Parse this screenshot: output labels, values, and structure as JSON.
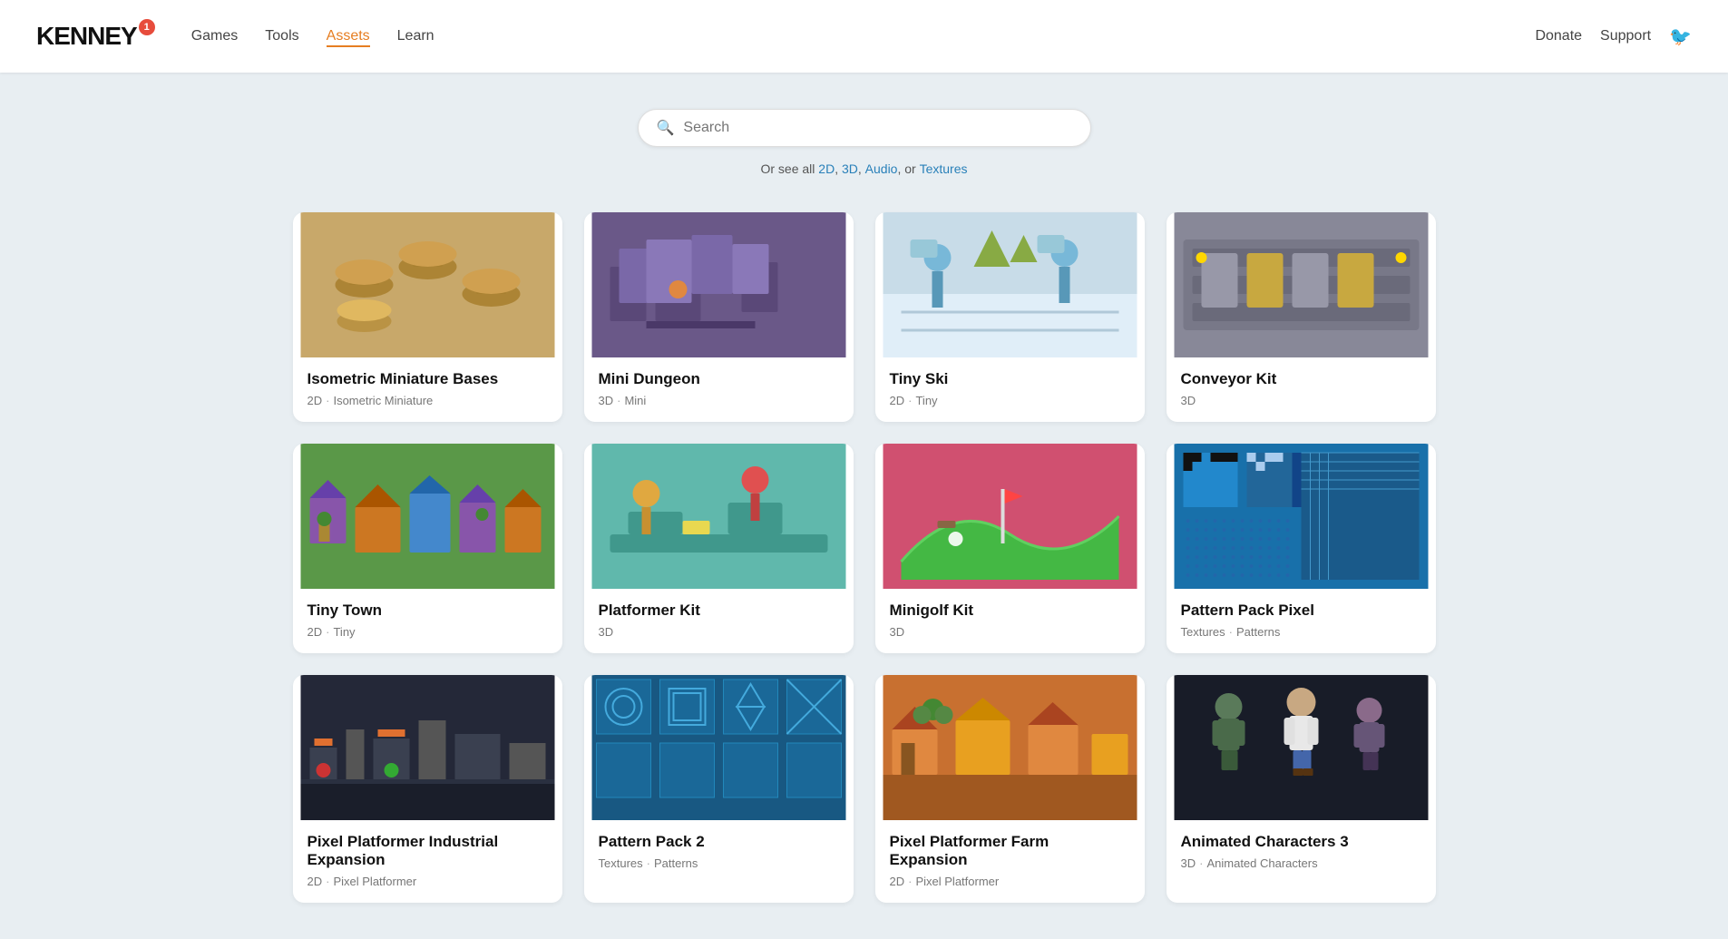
{
  "nav": {
    "logo": "KENNEY",
    "badge": "1",
    "links": [
      {
        "label": "Games",
        "href": "#",
        "active": false
      },
      {
        "label": "Tools",
        "href": "#",
        "active": false
      },
      {
        "label": "Assets",
        "href": "#",
        "active": true
      },
      {
        "label": "Learn",
        "href": "#",
        "active": false
      }
    ],
    "right_links": [
      {
        "label": "Donate",
        "href": "#"
      },
      {
        "label": "Support",
        "href": "#"
      }
    ]
  },
  "search": {
    "placeholder": "Search",
    "filter_text": "Or see all",
    "filter_links": [
      "2D",
      "3D",
      "Audio",
      "Textures"
    ]
  },
  "assets": [
    {
      "id": "isometric-miniature-bases",
      "title": "Isometric Miniature Bases",
      "tags": [
        "2D",
        "Isometric Miniature"
      ],
      "bg": "tan",
      "color1": "#c4a96e",
      "color2": "#d4b97e"
    },
    {
      "id": "mini-dungeon",
      "title": "Mini Dungeon",
      "tags": [
        "3D",
        "Mini"
      ],
      "bg": "purple",
      "color1": "#7c6fa0",
      "color2": "#9080b0"
    },
    {
      "id": "tiny-ski",
      "title": "Tiny Ski",
      "tags": [
        "2D",
        "Tiny"
      ],
      "bg": "lightblue",
      "color1": "#b8d8e8",
      "color2": "#d0eaf4"
    },
    {
      "id": "conveyor-kit",
      "title": "Conveyor Kit",
      "tags": [
        "3D"
      ],
      "bg": "gray",
      "color1": "#8a8a9a",
      "color2": "#9a9aaa"
    },
    {
      "id": "tiny-town",
      "title": "Tiny Town",
      "tags": [
        "2D",
        "Tiny"
      ],
      "bg": "green",
      "color1": "#5c9e4a",
      "color2": "#6cae5a"
    },
    {
      "id": "platformer-kit",
      "title": "Platformer Kit",
      "tags": [
        "3D"
      ],
      "bg": "teal",
      "color1": "#6ec4b8",
      "color2": "#8ed4c8"
    },
    {
      "id": "minigolf-kit",
      "title": "Minigolf Kit",
      "tags": [
        "3D"
      ],
      "bg": "pink",
      "color1": "#e86688",
      "color2": "#f87898"
    },
    {
      "id": "pattern-pack-pixel",
      "title": "Pattern Pack Pixel",
      "tags": [
        "Textures",
        "Patterns"
      ],
      "bg": "blue",
      "color1": "#1a7fbf",
      "color2": "#2a8fcf"
    },
    {
      "id": "pixel-platformer-industrial",
      "title": "Pixel Platformer Industrial Expansion",
      "tags": [
        "2D",
        "Pixel Platformer"
      ],
      "bg": "darkbg",
      "color1": "#2a3040",
      "color2": "#3a4050"
    },
    {
      "id": "pattern-pack-2",
      "title": "Pattern Pack 2",
      "tags": [
        "Textures",
        "Patterns"
      ],
      "bg": "bluegrid",
      "color1": "#1a6090",
      "color2": "#2a70a0"
    },
    {
      "id": "pixel-platformer-farm",
      "title": "Pixel Platformer Farm Expansion",
      "tags": [
        "2D",
        "Pixel Platformer"
      ],
      "bg": "orange",
      "color1": "#d4803a",
      "color2": "#e4904a"
    },
    {
      "id": "animated-characters-3",
      "title": "Animated Characters 3",
      "tags": [
        "3D",
        "Animated Characters"
      ],
      "bg": "dark",
      "color1": "#1a2030",
      "color2": "#2a3040"
    }
  ]
}
